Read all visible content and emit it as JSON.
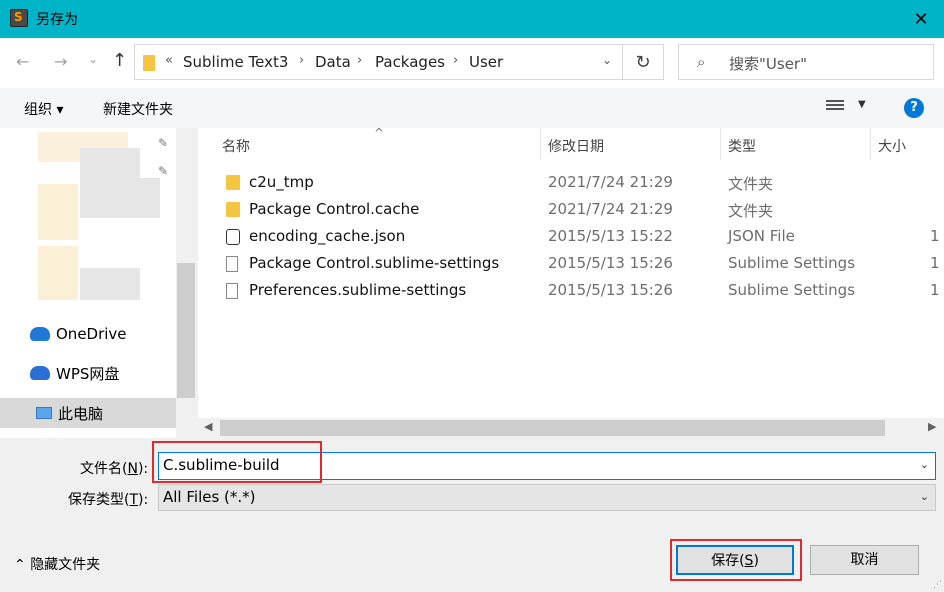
{
  "window": {
    "title": "另存为",
    "close_glyph": "✕"
  },
  "nav": {
    "back_glyph": "←",
    "forward_glyph": "→",
    "recent_glyph": "⌄",
    "up_glyph": "↑",
    "breadcrumb_prefix": "«",
    "breadcrumbs": [
      "Sublime Text3",
      "Data",
      "Packages",
      "User"
    ],
    "breadcrumb_sep": "›",
    "refresh_glyph": "↻",
    "search_placeholder": "搜索\"User\""
  },
  "toolbar": {
    "organize": "组织 ▾",
    "new_folder": "新建文件夹",
    "help": "?"
  },
  "sidebar": {
    "items": [
      {
        "label": "OneDrive"
      },
      {
        "label": "WPS网盘"
      },
      {
        "label": "此电脑"
      }
    ]
  },
  "columns": {
    "name": "名称",
    "date": "修改日期",
    "type": "类型",
    "size": "大小"
  },
  "files": [
    {
      "name": "c2u_tmp",
      "date": "2021/7/24 21:29",
      "type": "文件夹",
      "size": "",
      "icon": "folder-icon"
    },
    {
      "name": "Package Control.cache",
      "date": "2021/7/24 21:29",
      "type": "文件夹",
      "size": "",
      "icon": "folder-icon"
    },
    {
      "name": "encoding_cache.json",
      "date": "2015/5/13 15:22",
      "type": "JSON File",
      "size": "1",
      "icon": "json-file-icon"
    },
    {
      "name": "Package Control.sublime-settings",
      "date": "2015/5/13 15:26",
      "type": "Sublime Settings",
      "size": "1",
      "icon": "file-icon"
    },
    {
      "name": "Preferences.sublime-settings",
      "date": "2015/5/13 15:26",
      "type": "Sublime Settings",
      "size": "1",
      "icon": "file-icon"
    }
  ],
  "form": {
    "filename_label_pre": "文件名(",
    "filename_label_key": "N",
    "filename_label_post": "):",
    "filename_value": "C.sublime-build",
    "filetype_label_pre": "保存类型(",
    "filetype_label_key": "T",
    "filetype_label_post": "):",
    "filetype_value": "All Files (*.*)"
  },
  "footer": {
    "hide_folders": "隐藏文件夹",
    "save_pre": "保存(",
    "save_key": "S",
    "save_post": ")",
    "cancel": "取消"
  },
  "colors": {
    "titlebar": "#00b4c8",
    "accent": "#0078d7",
    "highlight": "#e0292e"
  }
}
